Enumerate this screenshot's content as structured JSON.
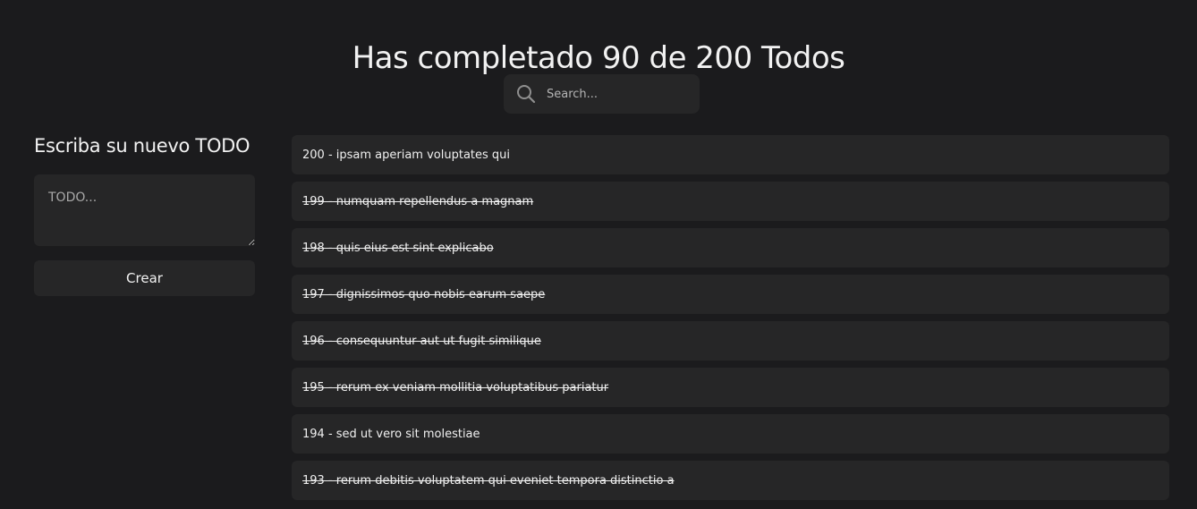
{
  "header": {
    "title": "Has completado 90 de 200 Todos"
  },
  "search": {
    "placeholder": "Search...",
    "value": "",
    "icon": "search-icon"
  },
  "create_panel": {
    "title": "Escriba su nuevo TODO",
    "textarea_placeholder": "TODO...",
    "textarea_value": "",
    "button_label": "Crear"
  },
  "todos": [
    {
      "text": "200 - ipsam aperiam voluptates qui",
      "completed": false
    },
    {
      "text": "199 - numquam repellendus a magnam",
      "completed": true
    },
    {
      "text": "198 - quis eius est sint explicabo",
      "completed": true
    },
    {
      "text": "197 - dignissimos quo nobis earum saepe",
      "completed": true
    },
    {
      "text": "196 - consequuntur aut ut fugit similique",
      "completed": true
    },
    {
      "text": "195 - rerum ex veniam mollitia voluptatibus pariatur",
      "completed": true
    },
    {
      "text": "194 - sed ut vero sit molestiae",
      "completed": false
    },
    {
      "text": "193 - rerum debitis voluptatem qui eveniet tempora distinctio a",
      "completed": true
    }
  ],
  "colors": {
    "background": "#1b1b1d",
    "surface": "#262627",
    "text": "#f2f2f2"
  }
}
